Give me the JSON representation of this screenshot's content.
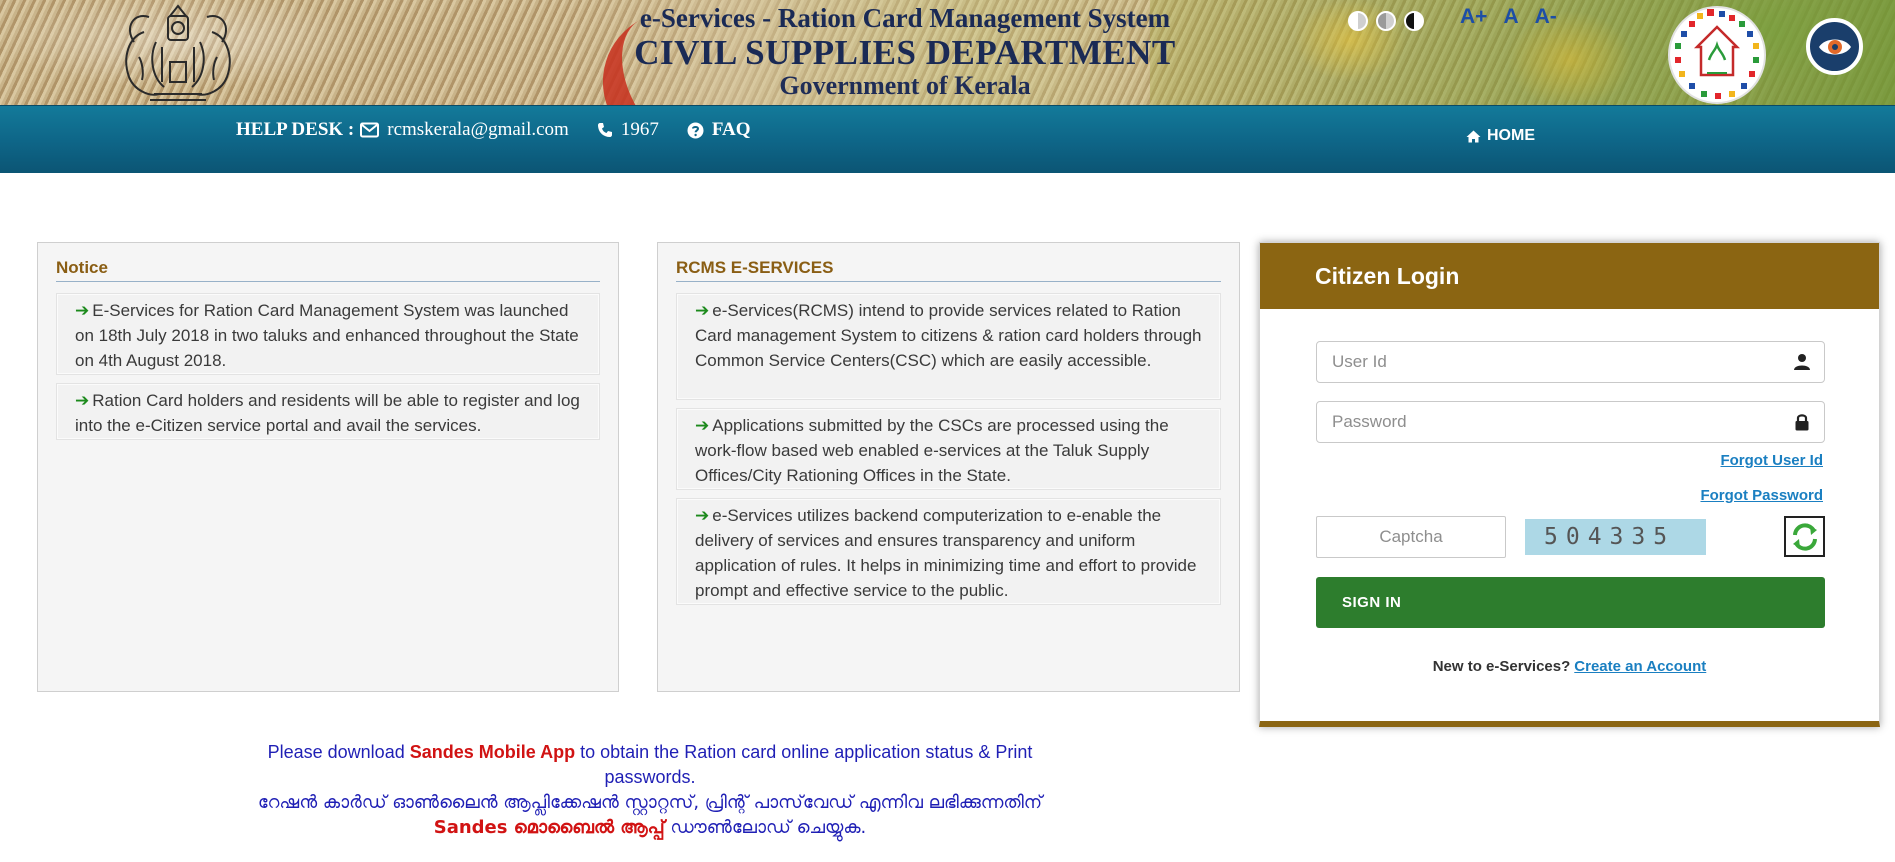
{
  "header": {
    "title_line1": "e-Services - Ration Card Management System",
    "title_line2": "CIVIL SUPPLIES DEPARTMENT",
    "title_line3": "Government of Kerala",
    "font_controls": [
      "A+",
      "A",
      "A-"
    ],
    "icons": [
      "kerala-emblem-icon",
      "high-contrast-icon",
      "medium-contrast-icon",
      "dark-contrast-icon",
      "civil-supplies-logo-icon",
      "eye-icon"
    ]
  },
  "navbar": {
    "helpdesk_label": "HELP DESK :",
    "email": "rcmskerala@gmail.com",
    "phone": "1967",
    "faq": "FAQ",
    "home": "HOME"
  },
  "notice": {
    "heading": "Notice",
    "items": [
      "E-Services for Ration Card Management System was launched on 18th July 2018 in two taluks and enhanced throughout the State on 4th August 2018.",
      "Ration Card holders and residents will be able to register and log into the e-Citizen service portal and avail the services."
    ]
  },
  "rcms": {
    "heading": "RCMS E-SERVICES",
    "items": [
      "e-Services(RCMS) intend to provide services related to Ration Card management System to citizens & ration card holders through Common Service Centers(CSC) which are easily accessible.",
      "Applications submitted by the CSCs are processed using the work-flow based web enabled e-services at the Taluk Supply Offices/City Rationing Offices in the State.",
      "e-Services utilizes backend computerization to e-enable the delivery of services and ensures transparency and uniform application of rules. It helps in minimizing time and effort to provide prompt and effective service to the public."
    ]
  },
  "login": {
    "heading": "Citizen Login",
    "user_placeholder": "User Id",
    "password_placeholder": "Password",
    "forgot_user": "Forgot User Id",
    "forgot_password": "Forgot Password",
    "captcha_placeholder": "Captcha",
    "captcha_code": "504335",
    "sign_in": "SIGN IN",
    "new_prompt": "New to e-Services?",
    "create_account": "Create an Account"
  },
  "download_note": {
    "en_prefix": "Please download",
    "en_app": "Sandes Mobile App",
    "en_suffix": "to obtain the Ration card online application status & Print passwords.",
    "ml_line1": "റേഷൻ കാർഡ് ഓൺലൈൻ ആപ്ലിക്കേഷൻ സ്റ്റാറ്റസ്, പ്രിന്റ് പാസ്‌വേഡ് എന്നിവ ലഭിക്കുന്നതിന്",
    "ml_app": "Sandes മൊബൈൽ ആപ്പ്",
    "ml_suffix": "ഡൗൺലോഡ് ചെയ്യുക."
  },
  "colors": {
    "nav_bar": "#0e6587",
    "login_header": "#8b6512",
    "signin_button": "#2d7d2d",
    "link": "#1a7fc1",
    "note_text": "#1f1fb5",
    "note_highlight": "#d11313"
  }
}
